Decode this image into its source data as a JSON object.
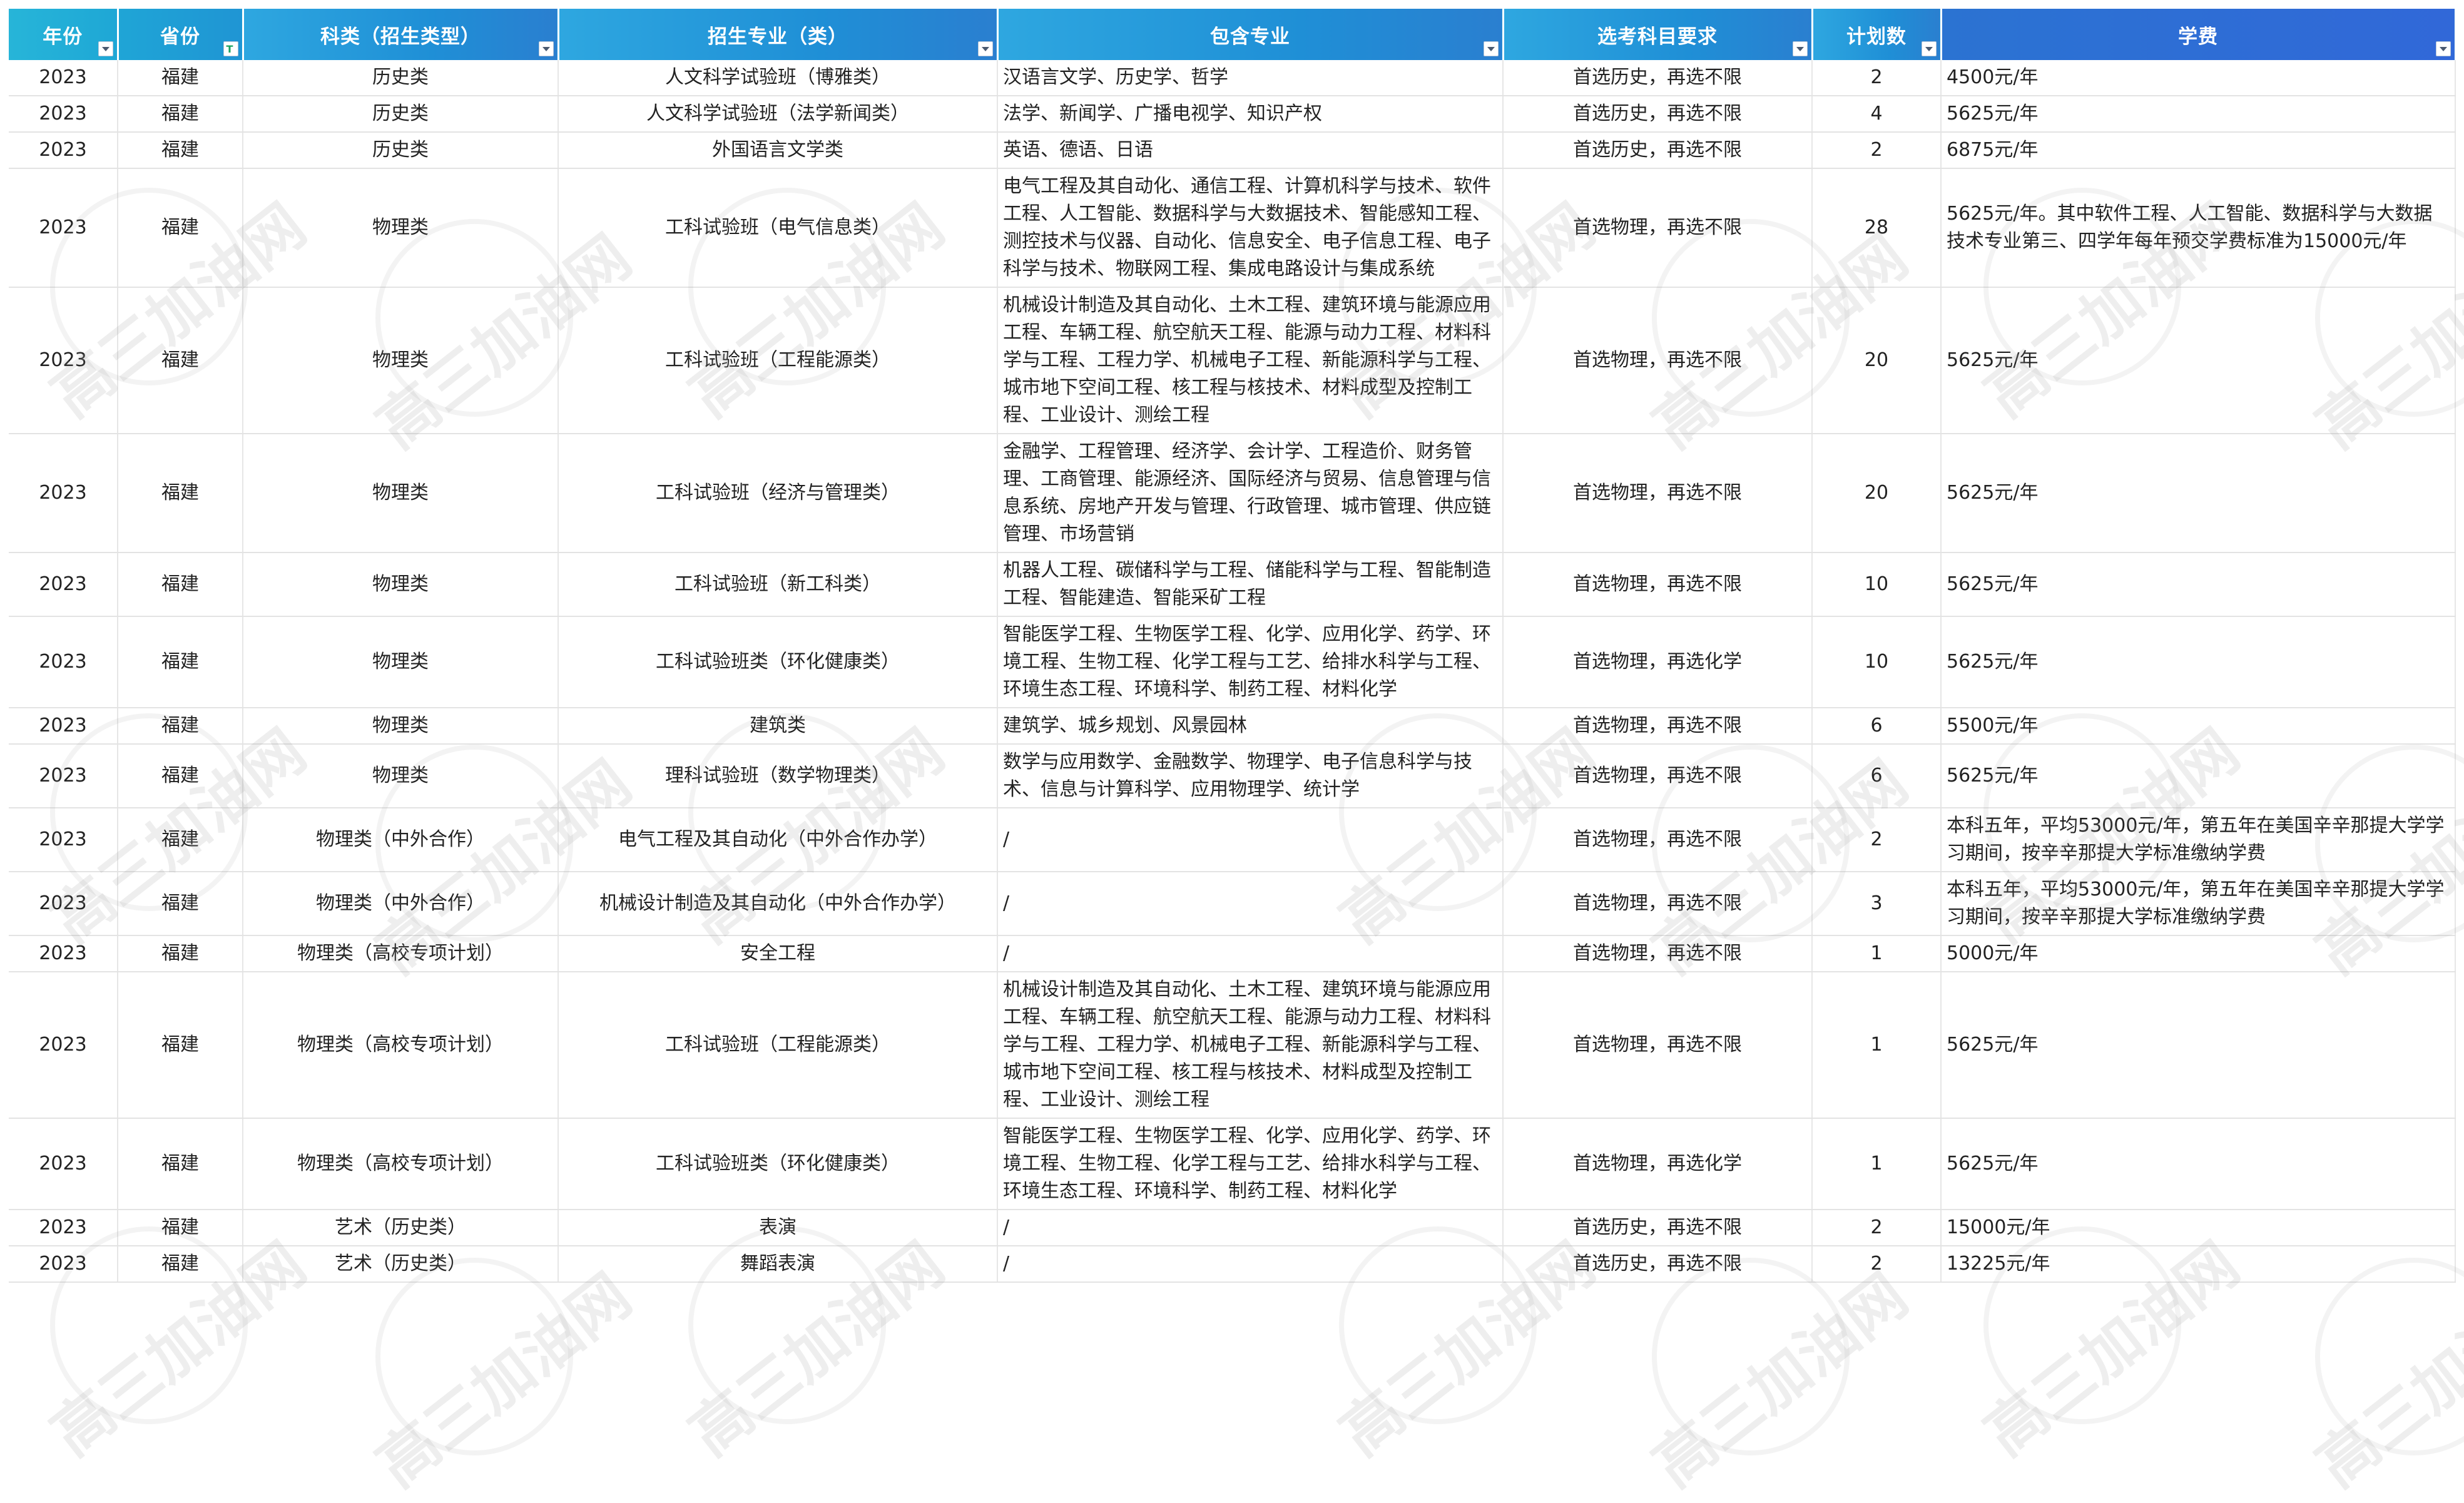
{
  "headers": [
    "年份",
    "省份",
    "科类（招生类型）",
    "招生专业（类）",
    "包含专业",
    "选考科目要求",
    "计划数",
    "学费"
  ],
  "rows": [
    [
      "2023",
      "福建",
      "历史类",
      "人文科学试验班（博雅类）",
      "汉语言文学、历史学、哲学",
      "首选历史，再选不限",
      "2",
      "4500元/年"
    ],
    [
      "2023",
      "福建",
      "历史类",
      "人文科学试验班（法学新闻类）",
      "法学、新闻学、广播电视学、知识产权",
      "首选历史，再选不限",
      "4",
      "5625元/年"
    ],
    [
      "2023",
      "福建",
      "历史类",
      "外国语言文学类",
      "英语、德语、日语",
      "首选历史，再选不限",
      "2",
      "6875元/年"
    ],
    [
      "2023",
      "福建",
      "物理类",
      "工科试验班（电气信息类）",
      "电气工程及其自动化、通信工程、计算机科学与技术、软件工程、人工智能、数据科学与大数据技术、智能感知工程、测控技术与仪器、自动化、信息安全、电子信息工程、电子科学与技术、物联网工程、集成电路设计与集成系统",
      "首选物理，再选不限",
      "28",
      "5625元/年。其中软件工程、人工智能、数据科学与大数据技术专业第三、四学年每年预交学费标准为15000元/年"
    ],
    [
      "2023",
      "福建",
      "物理类",
      "工科试验班（工程能源类）",
      "机械设计制造及其自动化、土木工程、建筑环境与能源应用工程、车辆工程、航空航天工程、能源与动力工程、材料科学与工程、工程力学、机械电子工程、新能源科学与工程、城市地下空间工程、核工程与核技术、材料成型及控制工程、工业设计、测绘工程",
      "首选物理，再选不限",
      "20",
      "5625元/年"
    ],
    [
      "2023",
      "福建",
      "物理类",
      "工科试验班（经济与管理类）",
      "金融学、工程管理、经济学、会计学、工程造价、财务管理、工商管理、能源经济、国际经济与贸易、信息管理与信息系统、房地产开发与管理、行政管理、城市管理、供应链管理、市场营销",
      "首选物理，再选不限",
      "20",
      "5625元/年"
    ],
    [
      "2023",
      "福建",
      "物理类",
      "工科试验班（新工科类）",
      "机器人工程、碳储科学与工程、储能科学与工程、智能制造工程、智能建造、智能采矿工程",
      "首选物理，再选不限",
      "10",
      "5625元/年"
    ],
    [
      "2023",
      "福建",
      "物理类",
      "工科试验班类（环化健康类）",
      "智能医学工程、生物医学工程、化学、应用化学、药学、环境工程、生物工程、化学工程与工艺、给排水科学与工程、环境生态工程、环境科学、制药工程、材料化学",
      "首选物理，再选化学",
      "10",
      "5625元/年"
    ],
    [
      "2023",
      "福建",
      "物理类",
      "建筑类",
      "建筑学、城乡规划、风景园林",
      "首选物理，再选不限",
      "6",
      "5500元/年"
    ],
    [
      "2023",
      "福建",
      "物理类",
      "理科试验班（数学物理类）",
      "数学与应用数学、金融数学、物理学、电子信息科学与技术、信息与计算科学、应用物理学、统计学",
      "首选物理，再选不限",
      "6",
      "5625元/年"
    ],
    [
      "2023",
      "福建",
      "物理类（中外合作）",
      "电气工程及其自动化（中外合作办学）",
      "/",
      "首选物理，再选不限",
      "2",
      "本科五年，平均53000元/年，第五年在美国辛辛那提大学学习期间，按辛辛那提大学标准缴纳学费"
    ],
    [
      "2023",
      "福建",
      "物理类（中外合作）",
      "机械设计制造及其自动化（中外合作办学）",
      "/",
      "首选物理，再选不限",
      "3",
      "本科五年，平均53000元/年，第五年在美国辛辛那提大学学习期间，按辛辛那提大学标准缴纳学费"
    ],
    [
      "2023",
      "福建",
      "物理类（高校专项计划）",
      "安全工程",
      "/",
      "首选物理，再选不限",
      "1",
      "5000元/年"
    ],
    [
      "2023",
      "福建",
      "物理类（高校专项计划）",
      "工科试验班（工程能源类）",
      "机械设计制造及其自动化、土木工程、建筑环境与能源应用工程、车辆工程、航空航天工程、能源与动力工程、材料科学与工程、工程力学、机械电子工程、新能源科学与工程、城市地下空间工程、核工程与核技术、材料成型及控制工程、工业设计、测绘工程",
      "首选物理，再选不限",
      "1",
      "5625元/年"
    ],
    [
      "2023",
      "福建",
      "物理类（高校专项计划）",
      "工科试验班类（环化健康类）",
      "智能医学工程、生物医学工程、化学、应用化学、药学、环境工程、生物工程、化学工程与工艺、给排水科学与工程、环境生态工程、环境科学、制药工程、材料化学",
      "首选物理，再选化学",
      "1",
      "5625元/年"
    ],
    [
      "2023",
      "福建",
      "艺术（历史类）",
      "表演",
      "/",
      "首选历史，再选不限",
      "2",
      "15000元/年"
    ],
    [
      "2023",
      "福建",
      "艺术（历史类）",
      "舞蹈表演",
      "/",
      "首选历史，再选不限",
      "2",
      "13225元/年"
    ]
  ],
  "watermark": "高三加油网",
  "colors": {
    "header_start": "#2ea7e0",
    "header_end": "#3168d8",
    "filter_active": "#1aa260"
  }
}
